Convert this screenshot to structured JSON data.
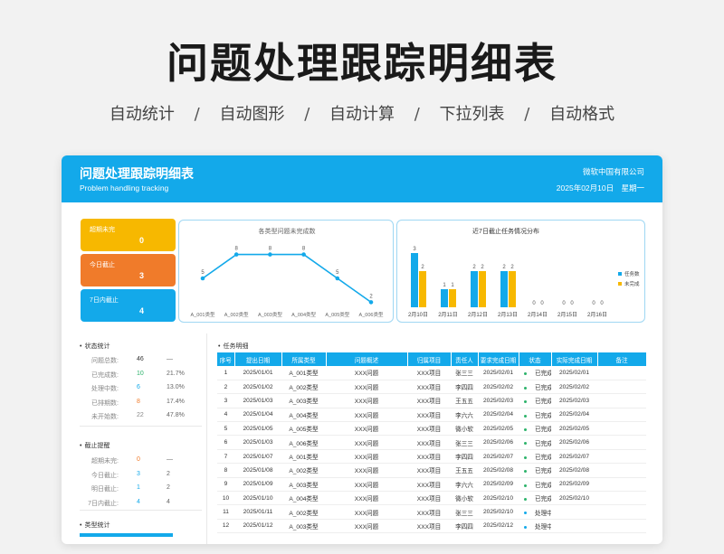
{
  "hero": {
    "title": "问题处理跟踪明细表",
    "tags": [
      "自动统计",
      "自动图形",
      "自动计算",
      "下拉列表",
      "自动格式"
    ],
    "separator": "/"
  },
  "header": {
    "title": "问题处理跟踪明细表",
    "subtitle": "Problem handling tracking",
    "company": "微软中国有限公司",
    "date": "2025年02月10日",
    "weekday": "星期一"
  },
  "kpis": [
    {
      "label": "超期未完",
      "value": "0",
      "color": "#f7b800"
    },
    {
      "label": "今日截止",
      "value": "3",
      "color": "#f07b2a"
    },
    {
      "label": "7日内截止",
      "value": "4",
      "color": "#13a9ea"
    }
  ],
  "chart_data": [
    {
      "type": "line",
      "title": "各类型问题未完成数",
      "categories": [
        "A_001类型",
        "A_002类型",
        "A_003类型",
        "A_004类型",
        "A_005类型",
        "A_006类型"
      ],
      "values": [
        5,
        8,
        8,
        8,
        5,
        2
      ],
      "ylim": [
        0,
        10
      ],
      "color": "#13a9ea"
    },
    {
      "type": "bar",
      "title": "近7日截止任务情况分布",
      "categories": [
        "2月10日",
        "2月11日",
        "2月12日",
        "2月13日",
        "2月14日",
        "2月15日",
        "2月16日"
      ],
      "series": [
        {
          "name": "任务数",
          "values": [
            3,
            1,
            2,
            2,
            0,
            0,
            0
          ],
          "color": "#13a9ea"
        },
        {
          "name": "未完成",
          "values": [
            2,
            1,
            2,
            2,
            0,
            0,
            0
          ],
          "color": "#f7b800"
        }
      ],
      "ylim": [
        0,
        3.5
      ],
      "legend": "right"
    }
  ],
  "status": {
    "title": "状态统计",
    "rows": [
      {
        "label": "问题总数:",
        "count": "46",
        "pct": "—",
        "color": "#333333"
      },
      {
        "label": "已完成数:",
        "count": "10",
        "pct": "21.7%",
        "color": "#2db36b"
      },
      {
        "label": "处理中数:",
        "count": "6",
        "pct": "13.0%",
        "color": "#13a9ea"
      },
      {
        "label": "已排期数:",
        "count": "8",
        "pct": "17.4%",
        "color": "#f07b2a"
      },
      {
        "label": "未开始数:",
        "count": "22",
        "pct": "47.8%",
        "color": "#888888"
      }
    ]
  },
  "deadline": {
    "title": "截止提醒",
    "rows": [
      {
        "label": "超期未完:",
        "a": "0",
        "b": "—",
        "color": "#f07b2a"
      },
      {
        "label": "今日截止:",
        "a": "3",
        "b": "2",
        "color": "#13a9ea"
      },
      {
        "label": "明日截止:",
        "a": "1",
        "b": "2",
        "color": "#13a9ea"
      },
      {
        "label": "7日内截止:",
        "a": "4",
        "b": "4",
        "color": "#13a9ea"
      }
    ]
  },
  "type_stats": {
    "title": "类型统计"
  },
  "table": {
    "title": "任务明细",
    "headers": [
      "序号",
      "提出日期",
      "所属类型",
      "问题概述",
      "归属项目",
      "责任人",
      "要求完成日期",
      "状态",
      "实际完成日期",
      "备注"
    ],
    "rows": [
      [
        "1",
        "2025/01/01",
        "A_001类型",
        "XXX问题",
        "XXX项目",
        "张三三",
        "2025/02/01",
        "已完成",
        "2025/02/01",
        ""
      ],
      [
        "2",
        "2025/01/02",
        "A_002类型",
        "XXX问题",
        "XXX项目",
        "李四四",
        "2025/02/02",
        "已完成",
        "2025/02/02",
        ""
      ],
      [
        "3",
        "2025/01/03",
        "A_003类型",
        "XXX问题",
        "XXX项目",
        "王五五",
        "2025/02/03",
        "已完成",
        "2025/02/03",
        ""
      ],
      [
        "4",
        "2025/01/04",
        "A_004类型",
        "XXX问题",
        "XXX项目",
        "李六六",
        "2025/02/04",
        "已完成",
        "2025/02/04",
        ""
      ],
      [
        "5",
        "2025/01/05",
        "A_005类型",
        "XXX问题",
        "XXX项目",
        "微小软",
        "2025/02/05",
        "已完成",
        "2025/02/05",
        ""
      ],
      [
        "6",
        "2025/01/03",
        "A_006类型",
        "XXX问题",
        "XXX项目",
        "张三三",
        "2025/02/06",
        "已完成",
        "2025/02/06",
        ""
      ],
      [
        "7",
        "2025/01/07",
        "A_001类型",
        "XXX问题",
        "XXX项目",
        "李四四",
        "2025/02/07",
        "已完成",
        "2025/02/07",
        ""
      ],
      [
        "8",
        "2025/01/08",
        "A_002类型",
        "XXX问题",
        "XXX项目",
        "王五五",
        "2025/02/08",
        "已完成",
        "2025/02/08",
        ""
      ],
      [
        "9",
        "2025/01/09",
        "A_003类型",
        "XXX问题",
        "XXX项目",
        "李六六",
        "2025/02/09",
        "已完成",
        "2025/02/09",
        ""
      ],
      [
        "10",
        "2025/01/10",
        "A_004类型",
        "XXX问题",
        "XXX项目",
        "微小软",
        "2025/02/10",
        "已完成",
        "2025/02/10",
        ""
      ],
      [
        "11",
        "2025/01/11",
        "A_002类型",
        "XXX问题",
        "XXX项目",
        "张三三",
        "2025/02/10",
        "处理中",
        "",
        ""
      ],
      [
        "12",
        "2025/01/12",
        "A_003类型",
        "XXX问题",
        "XXX项目",
        "李四四",
        "2025/02/12",
        "处理中",
        "",
        ""
      ]
    ]
  }
}
